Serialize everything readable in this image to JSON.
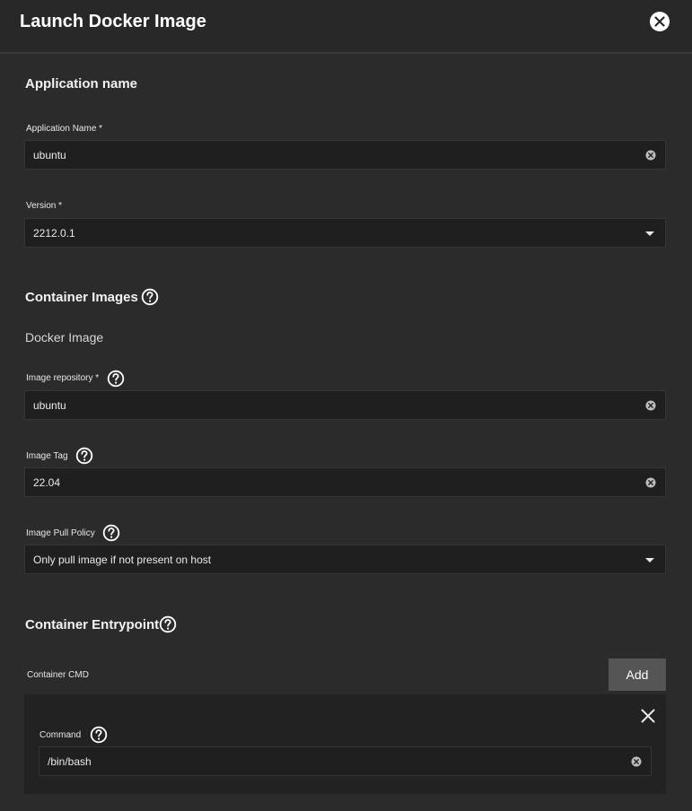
{
  "dialog": {
    "title": "Launch Docker Image",
    "close_icon": "close-circle-icon"
  },
  "application": {
    "section_title": "Application name",
    "name_label": "Application Name *",
    "name_value": "ubuntu",
    "version_label": "Version *",
    "version_value": "2212.0.1"
  },
  "images": {
    "section_title": "Container Images",
    "subheading": "Docker Image",
    "repo_label": "Image repository *",
    "repo_value": "ubuntu",
    "tag_label": "Image Tag",
    "tag_value": "22.04",
    "pull_label": "Image Pull Policy",
    "pull_value": "Only pull image if not present on host"
  },
  "entrypoint": {
    "section_title": "Container Entrypoint",
    "cmd_label": "Container CMD",
    "add_label": "Add",
    "command_label": "Command",
    "command_value": "/bin/bash"
  },
  "colors": {
    "background": "#2b2b2b",
    "field": "#1f1f1f",
    "button": "#555555"
  }
}
